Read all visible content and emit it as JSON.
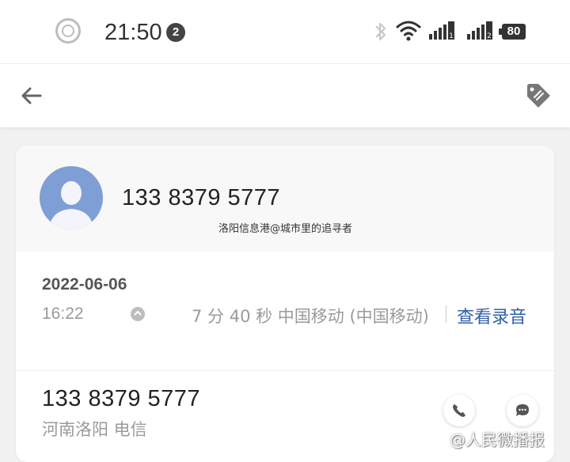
{
  "status_bar": {
    "time": "21:50",
    "notification_count": "2",
    "battery": "80",
    "sim1": "1",
    "sim2": "2"
  },
  "contact": {
    "number": "133 8379 5777",
    "watermark": "洛阳信息港@城市里的追寻者"
  },
  "call_record": {
    "date": "2022-06-06",
    "time": "16:22",
    "info": "7 分 40 秒 中国移动 (中国移动)",
    "view_recording": "查看录音"
  },
  "number_row": {
    "number": "133 8379 5777",
    "location": "河南洛阳 电信"
  },
  "overlay": {
    "weibo": "@人民微播报"
  },
  "colors": {
    "accent_link": "#2f5fa8",
    "avatar_bg": "#7f9ed6",
    "page_bg": "#f1f1f1"
  },
  "icons": {
    "back": "arrow-left-icon",
    "tag": "tag-icon",
    "bluetooth": "bluetooth-icon",
    "wifi": "wifi-icon",
    "call": "phone-icon",
    "message": "message-icon"
  }
}
